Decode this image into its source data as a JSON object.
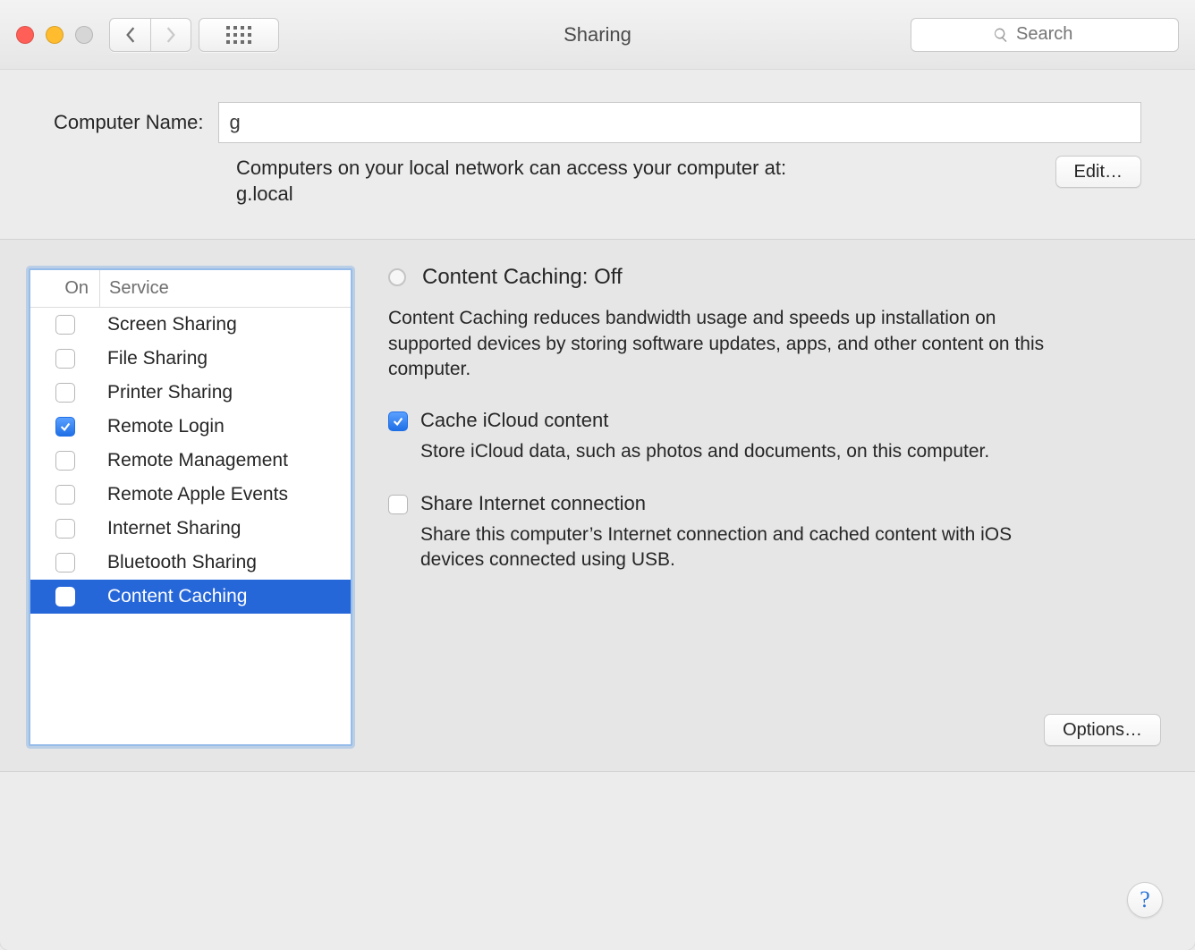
{
  "titlebar": {
    "title": "Sharing",
    "search_placeholder": "Search"
  },
  "computer_name": {
    "label": "Computer Name:",
    "value": "g",
    "hint_prefix": "Computers on your local network can access your computer at:",
    "hostname": "g.local",
    "edit_label": "Edit…"
  },
  "services": {
    "header_on": "On",
    "header_service": "Service",
    "items": [
      {
        "label": "Screen Sharing",
        "on": false,
        "selected": false
      },
      {
        "label": "File Sharing",
        "on": false,
        "selected": false
      },
      {
        "label": "Printer Sharing",
        "on": false,
        "selected": false
      },
      {
        "label": "Remote Login",
        "on": true,
        "selected": false
      },
      {
        "label": "Remote Management",
        "on": false,
        "selected": false
      },
      {
        "label": "Remote Apple Events",
        "on": false,
        "selected": false
      },
      {
        "label": "Internet Sharing",
        "on": false,
        "selected": false
      },
      {
        "label": "Bluetooth Sharing",
        "on": false,
        "selected": false
      },
      {
        "label": "Content Caching",
        "on": false,
        "selected": true
      }
    ]
  },
  "detail": {
    "status_title": "Content Caching: Off",
    "description": "Content Caching reduces bandwidth usage and speeds up installation on supported devices by storing software updates, apps, and other content on this computer.",
    "options": [
      {
        "label": "Cache iCloud content",
        "sub": "Store iCloud data, such as photos and documents, on this computer.",
        "checked": true
      },
      {
        "label": "Share Internet connection",
        "sub": "Share this computer’s Internet connection and cached content with iOS devices connected using USB.",
        "checked": false
      }
    ],
    "options_button": "Options…"
  },
  "help_label": "?"
}
